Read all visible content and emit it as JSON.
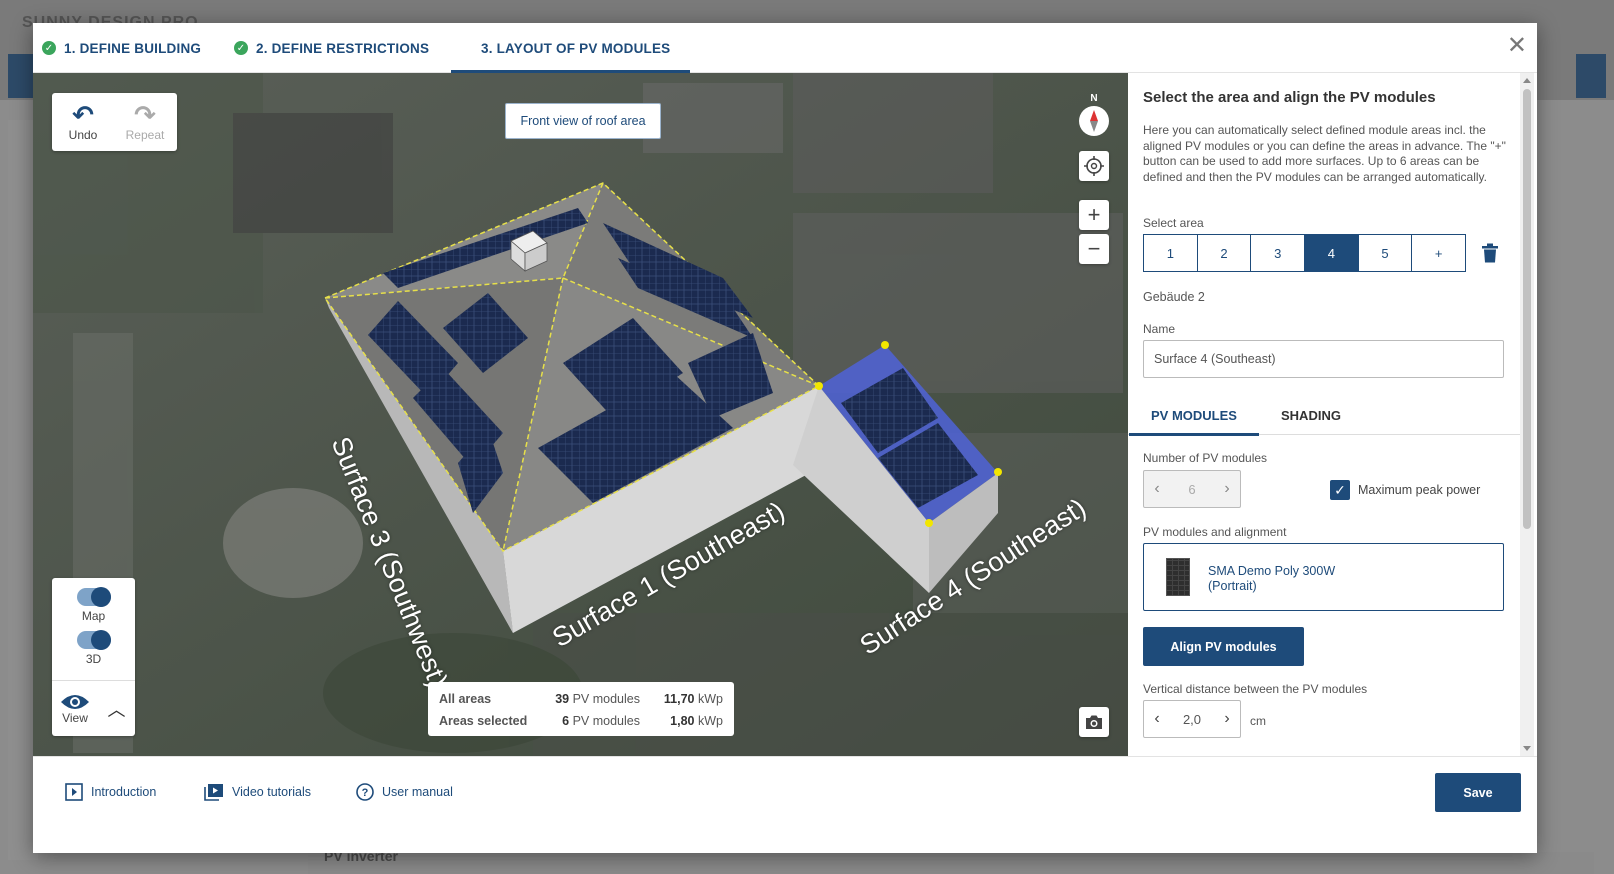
{
  "background": {
    "app_title": "SUNNY DESIGN PRO",
    "bottom_section": "PV inverter"
  },
  "tabs": [
    {
      "label": "1. DEFINE BUILDING",
      "done": true
    },
    {
      "label": "2. DEFINE RESTRICTIONS",
      "done": true
    },
    {
      "label": "3. LAYOUT OF PV MODULES",
      "done": false,
      "active": true
    }
  ],
  "map": {
    "undo_label": "Undo",
    "repeat_label": "Repeat",
    "front_view_label": "Front view of roof area",
    "compass_label": "N",
    "map_toggle_label": "Map",
    "threed_toggle_label": "3D",
    "view_label": "View",
    "surface_labels": {
      "s1": "Surface 1 (Southeast)",
      "s3": "Surface 3 (Southwest)",
      "s4": "Surface 4 (Southeast)"
    },
    "stats": {
      "all_label": "All areas",
      "all_modules": "39",
      "all_power": "11,70",
      "sel_label": "Areas selected",
      "sel_modules": "6",
      "sel_power": "1,80",
      "modules_unit": "PV modules",
      "power_unit": "kWp"
    }
  },
  "panel": {
    "title": "Select the area and align the PV modules",
    "description": "Here you can automatically select defined module areas incl. the aligned PV modules or you can define the areas in advance. The \"+\" button can be used to add more surfaces. Up to 6 areas can be defined and then the PV modules can be arranged automatically.",
    "select_area_label": "Select area",
    "areas": [
      "1",
      "2",
      "3",
      "4",
      "5",
      "+"
    ],
    "selected_area": "4",
    "building_name": "Gebäude 2",
    "name_label": "Name",
    "name_value": "Surface 4 (Southeast)",
    "subtabs": [
      "PV MODULES",
      "SHADING"
    ],
    "num_modules_label": "Number of PV modules",
    "num_modules_value": "6",
    "max_peak_label": "Maximum peak power",
    "max_peak_checked": true,
    "modules_alignment_label": "PV modules and alignment",
    "module_name": "SMA Demo Poly 300W",
    "module_orientation": "(Portrait)",
    "align_button": "Align PV modules",
    "vertical_distance_label": "Vertical distance between the PV modules",
    "vertical_distance_value": "2,0",
    "vertical_distance_unit": "cm"
  },
  "footer": {
    "introduction": "Introduction",
    "video_tutorials": "Video tutorials",
    "user_manual": "User manual",
    "save": "Save"
  },
  "colors": {
    "primary": "#1e4b7a",
    "success": "#3ba55c",
    "highlight_area": "#3a4fd0",
    "ridge_line": "#e7e04a"
  }
}
